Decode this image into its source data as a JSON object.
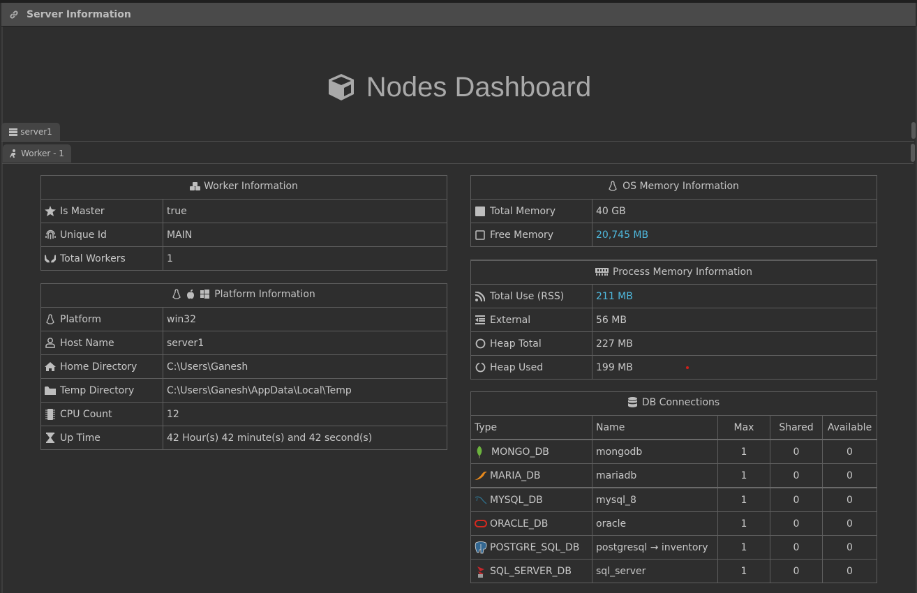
{
  "panel": {
    "title": "Server Information",
    "icon": "link-icon"
  },
  "dashboard": {
    "title": "Nodes Dashboard",
    "icon": "cube-icon"
  },
  "tabs": {
    "server": {
      "label": "server1",
      "icon": "server-icon"
    },
    "worker": {
      "label": "Worker - 1",
      "icon": "worker-icon"
    }
  },
  "worker_info": {
    "title": "Worker Information",
    "icon": "cubes-icon",
    "rows": [
      {
        "label": "Is Master",
        "value": "true",
        "icon": "star-icon"
      },
      {
        "label": "Unique Id",
        "value": "MAIN",
        "icon": "fingerprint-icon"
      },
      {
        "label": "Total Workers",
        "value": "1",
        "icon": "hands-icon"
      }
    ]
  },
  "platform_info": {
    "title": "Platform Information",
    "icons": [
      "linux-icon",
      "apple-icon",
      "windows-icon"
    ],
    "rows": [
      {
        "label": "Platform",
        "value": "win32",
        "icon": "linux-icon"
      },
      {
        "label": "Host Name",
        "value": "server1",
        "icon": "user-icon"
      },
      {
        "label": "Home Directory",
        "value": "C:\\Users\\Ganesh",
        "icon": "home-icon"
      },
      {
        "label": "Temp Directory",
        "value": "C:\\Users\\Ganesh\\AppData\\Local\\Temp",
        "icon": "folder-icon"
      },
      {
        "label": "CPU Count",
        "value": "12",
        "icon": "cpu-icon"
      },
      {
        "label": "Up Time",
        "value": "42 Hour(s) 42 minute(s) and 42 second(s)",
        "icon": "hourglass-icon"
      }
    ]
  },
  "os_memory": {
    "title": "OS Memory Information",
    "icon": "linux-icon",
    "rows": [
      {
        "label": "Total Memory",
        "value": "40 GB",
        "icon": "filled-square-icon"
      },
      {
        "label": "Free Memory",
        "value": "20,745 MB",
        "icon": "empty-square-icon",
        "highlight": "#4fb8dd"
      }
    ]
  },
  "process_memory": {
    "title": "Process Memory Information",
    "icon": "memory-icon",
    "rows": [
      {
        "label": "Total Use (RSS)",
        "value": "211 MB",
        "icon": "rss-icon",
        "highlight": "#4fb8dd"
      },
      {
        "label": "External",
        "value": "56 MB",
        "icon": "outdent-icon"
      },
      {
        "label": "Heap Total",
        "value": "227 MB",
        "icon": "circle-icon"
      },
      {
        "label": "Heap Used",
        "value": "199 MB",
        "icon": "circle-notch-icon"
      }
    ]
  },
  "db_connections": {
    "title": "DB Connections",
    "icon": "database-icon",
    "columns": [
      "Type",
      "Name",
      "Max",
      "Shared",
      "Available"
    ],
    "rows": [
      {
        "type": "MONGO_DB",
        "name": "mongodb",
        "max": "1",
        "shared": "0",
        "available": "0",
        "icon": "mongodb-leaf-icon"
      },
      {
        "type": "MARIA_DB",
        "name": "mariadb",
        "max": "1",
        "shared": "0",
        "available": "0",
        "icon": "mariadb-seal-icon"
      },
      {
        "type": "MYSQL_DB",
        "name": "mysql_8",
        "max": "1",
        "shared": "0",
        "available": "0",
        "icon": "mysql-dolphin-icon"
      },
      {
        "type": "ORACLE_DB",
        "name": "oracle",
        "max": "1",
        "shared": "0",
        "available": "0",
        "icon": "oracle-ring-icon"
      },
      {
        "type": "POSTGRE_SQL_DB",
        "name": "postgresql → inventory",
        "max": "1",
        "shared": "0",
        "available": "0",
        "icon": "postgresql-elephant-icon"
      },
      {
        "type": "SQL_SERVER_DB",
        "name": "sql_server",
        "max": "1",
        "shared": "0",
        "available": "0",
        "icon": "sqlserver-icon"
      }
    ]
  },
  "colors": {
    "background": "#2e2e2e",
    "header": "#4a4a4a",
    "text": "#c8c8c8",
    "accent": "#4fb8dd",
    "border": "#5e5e5e"
  }
}
